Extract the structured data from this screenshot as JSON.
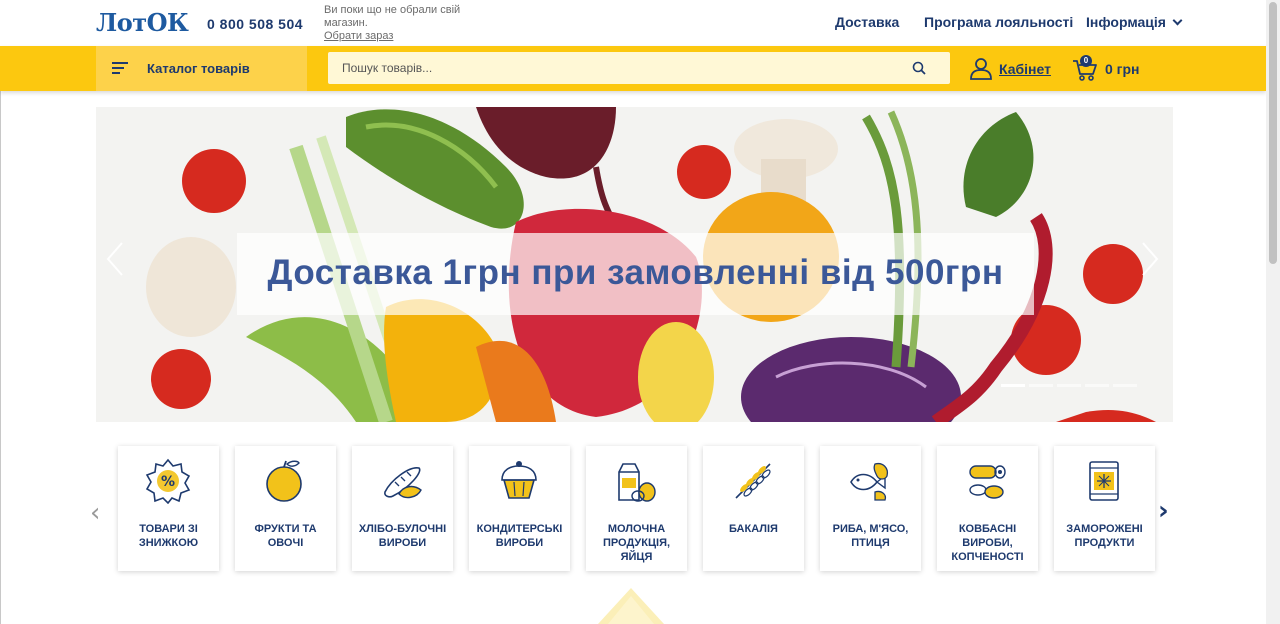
{
  "header": {
    "logo": "ЛотОК",
    "phone": "0 800 508 504",
    "store_note": "Ви поки що не обрали свій магазин.",
    "store_link": "Обрати зараз",
    "nav": [
      "Доставка",
      "Програма лояльності",
      "Інформація"
    ]
  },
  "toolbar": {
    "catalog_label": "Каталог товарів",
    "search_placeholder": "Пошук товарів...",
    "cabinet_label": "Кабінет",
    "cart_count": "0",
    "cart_total": "0 грн"
  },
  "banner": {
    "text": "Доставка 1грн при замовленні від 500грн",
    "slides": 5,
    "active_slide": 1
  },
  "categories": [
    {
      "label": "Товари зі знижкою",
      "icon": "discount-badge-icon"
    },
    {
      "label": "Фрукти та овочі",
      "icon": "apple-icon"
    },
    {
      "label": "Хлібо-булочні вироби",
      "icon": "bread-icon"
    },
    {
      "label": "Кондитерські вироби",
      "icon": "cupcake-icon"
    },
    {
      "label": "Молочна продукція, яйця",
      "icon": "milk-eggs-icon"
    },
    {
      "label": "Бакалія",
      "icon": "wheat-icon"
    },
    {
      "label": "Риба, м'ясо, птиця",
      "icon": "fish-meat-icon"
    },
    {
      "label": "Ковбасні вироби, копченості",
      "icon": "sausage-icon"
    },
    {
      "label": "Заморожені продукти",
      "icon": "frozen-icon"
    }
  ],
  "colors": {
    "primary": "#1e3a6e",
    "accent": "#fcc80f",
    "icon_yellow": "#f2c21a"
  }
}
